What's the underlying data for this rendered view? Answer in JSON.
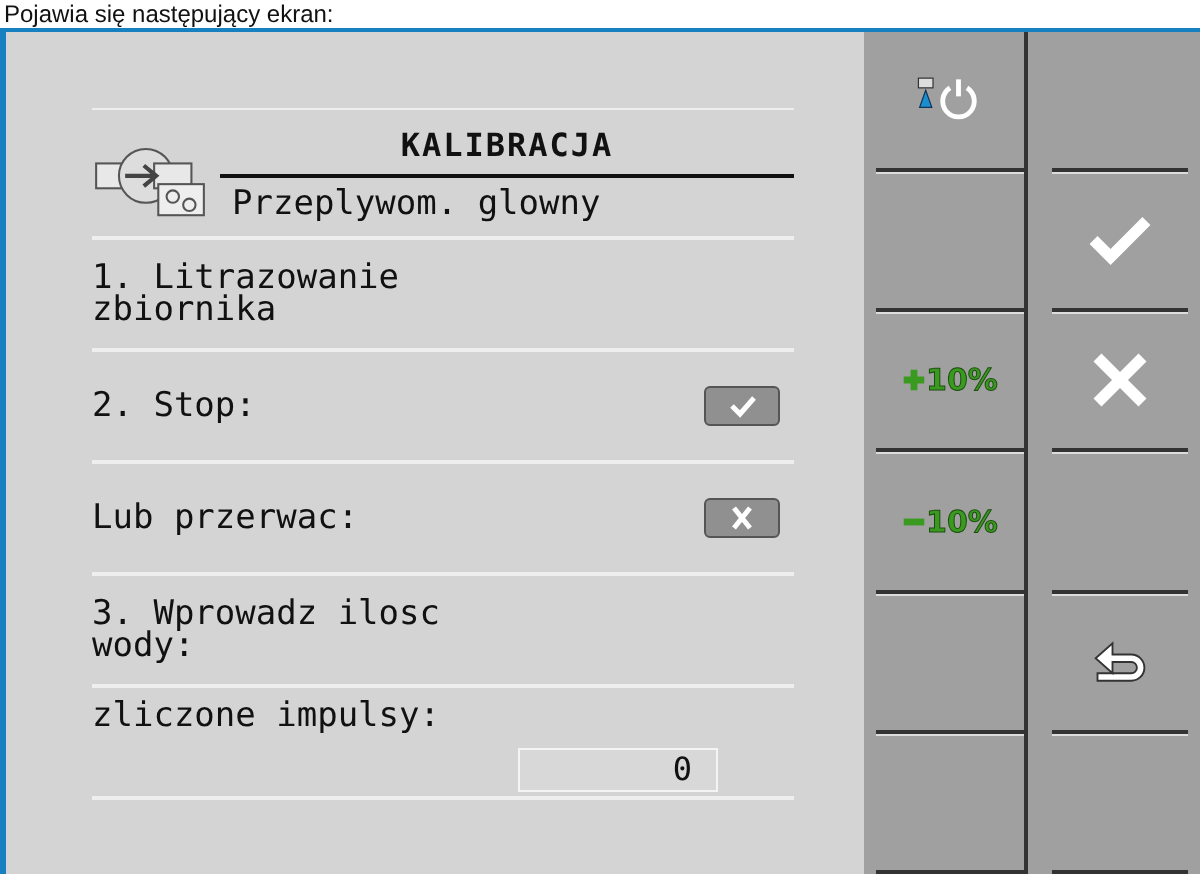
{
  "caption": "Pojawia się następujący ekran:",
  "header": {
    "title": "KALIBRACJA",
    "subtitle": "Przeplywom. glowny"
  },
  "rows": [
    {
      "kind": "text",
      "label": "1. Litrazowanie\nzbiornika"
    },
    {
      "kind": "confirm",
      "label": "2. Stop:"
    },
    {
      "kind": "cancel",
      "label": "Lub przerwac:"
    },
    {
      "kind": "text",
      "label": "3. Wprowadz ilosc\nwody:"
    },
    {
      "kind": "value",
      "label": "zliczone impulsy:",
      "value": "0"
    }
  ],
  "buttons": [
    {
      "kind": "power"
    },
    {
      "kind": "empty"
    },
    {
      "kind": "empty"
    },
    {
      "kind": "check"
    },
    {
      "kind": "plus",
      "label": "10%"
    },
    {
      "kind": "cross"
    },
    {
      "kind": "minus",
      "label": "10%"
    },
    {
      "kind": "empty"
    },
    {
      "kind": "empty"
    },
    {
      "kind": "back"
    },
    {
      "kind": "empty"
    },
    {
      "kind": "empty"
    }
  ]
}
